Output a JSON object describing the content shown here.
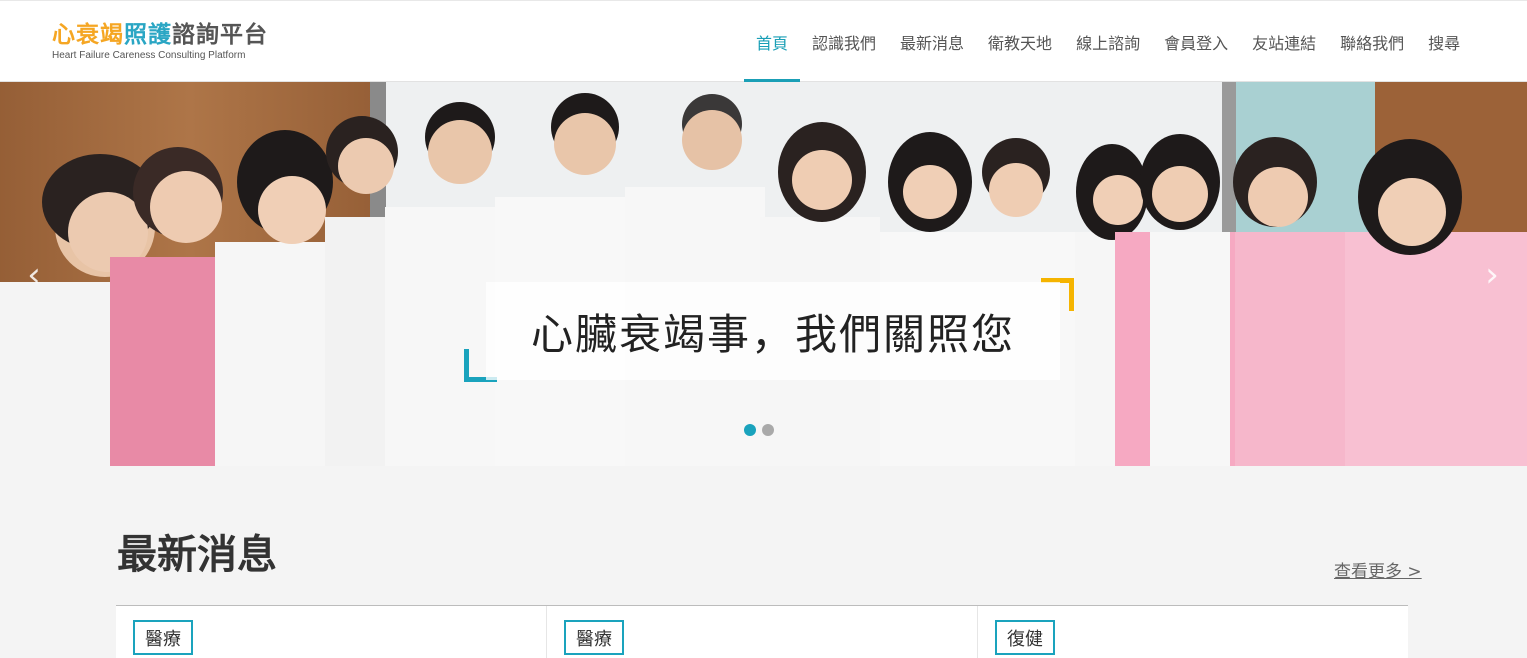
{
  "header": {
    "logo": {
      "title_part1": "心衰竭",
      "title_part2": "照護",
      "title_part3": "諮詢平台",
      "subtitle": "Heart Failure Careness Consulting Platform"
    },
    "nav": [
      {
        "label": "首頁",
        "active": true
      },
      {
        "label": "認識我們"
      },
      {
        "label": "最新消息"
      },
      {
        "label": "衛教天地"
      },
      {
        "label": "線上諮詢"
      },
      {
        "label": "會員登入"
      },
      {
        "label": "友站連結"
      },
      {
        "label": "聯絡我們"
      },
      {
        "label": "搜尋"
      }
    ]
  },
  "hero": {
    "caption": "心臟衰竭事，我們關照您",
    "slide_count": 2,
    "active_slide": 1,
    "prev_icon": "chevron-left-icon",
    "next_icon": "chevron-right-icon"
  },
  "news": {
    "title": "最新消息",
    "more_label": "查看更多 >",
    "cards": [
      {
        "tag": "醫療"
      },
      {
        "tag": "醫療"
      },
      {
        "tag": "復健"
      }
    ]
  },
  "colors": {
    "accent": "#1aa3bd",
    "logo_orange": "#f5a623",
    "logo_blue": "#2aa6c4",
    "bracket_yellow": "#f5b400"
  }
}
